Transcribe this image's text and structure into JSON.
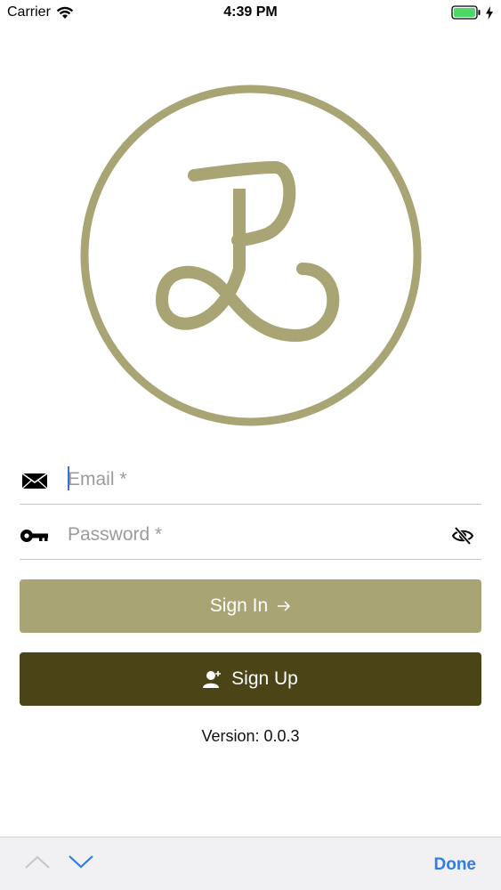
{
  "status_bar": {
    "carrier": "Carrier",
    "time": "4:39 PM",
    "battery_color": "#4cd964"
  },
  "brand": {
    "logo_icon": "jp-monogram-logo",
    "accent_color": "#a9a474",
    "dark_color": "#4a4417"
  },
  "form": {
    "email": {
      "icon": "envelope-icon",
      "placeholder": "Email *",
      "value": ""
    },
    "password": {
      "icon": "key-icon",
      "placeholder": "Password *",
      "value": "",
      "toggle_icon": "eye-slash-icon"
    }
  },
  "buttons": {
    "sign_in_label": "Sign In",
    "sign_in_icon": "arrow-right-icon",
    "sign_up_label": "Sign Up",
    "sign_up_icon": "add-user-icon"
  },
  "footer": {
    "version": "Version: 0.0.3"
  },
  "keyboard_toolbar": {
    "prev_icon": "chevron-up-icon",
    "next_icon": "chevron-down-icon",
    "done_label": "Done"
  }
}
